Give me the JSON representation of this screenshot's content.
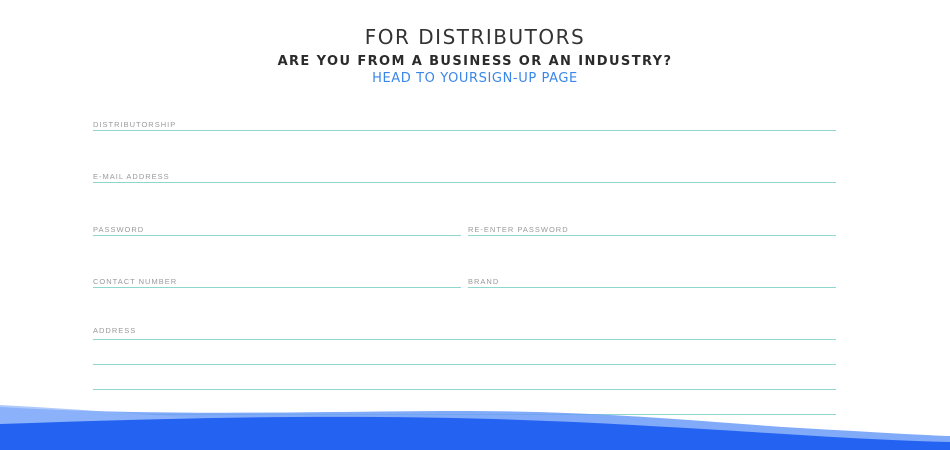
{
  "header": {
    "title": "FOR DISTRIBUTORS",
    "subtitle": "ARE YOU FROM A BUSINESS OR AN INDUSTRY?",
    "signup_link": "HEAD TO YOURSIGN-UP PAGE"
  },
  "form": {
    "distributorship_label": "DISTRIBUTORSHIP",
    "email_label": "E-MAIL ADDRESS",
    "password_label": "PASSWORD",
    "reenter_password_label": "RE-ENTER PASSWORD",
    "contact_number_label": "CONTACT NUMBER",
    "brand_label": "BRAND",
    "address_label": "ADDRESS"
  },
  "colors": {
    "accent_link": "#3a86e8",
    "field_underline": "#8fd6cf",
    "wave_primary": "#2462f2",
    "wave_secondary": "#5a8ff7"
  }
}
